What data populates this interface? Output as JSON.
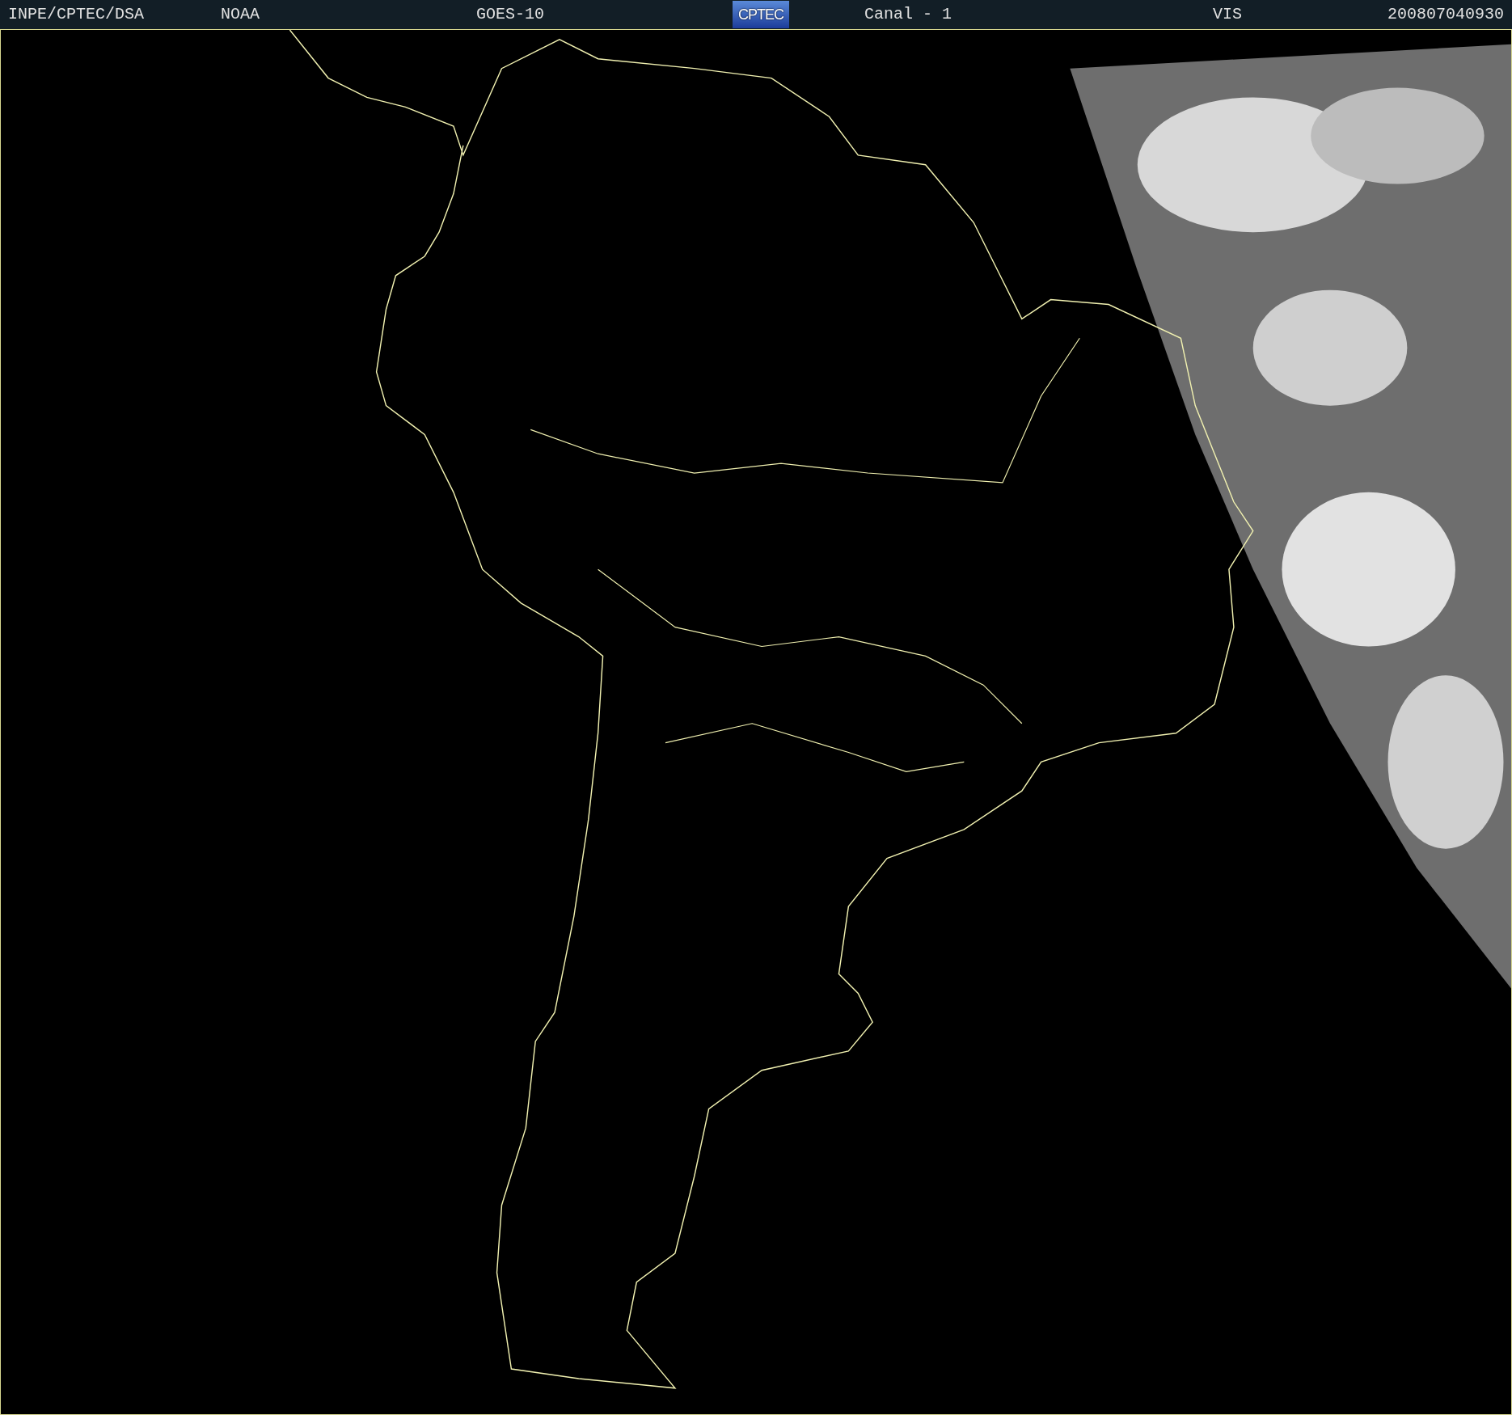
{
  "header": {
    "items": [
      {
        "kind": "text",
        "text": "INPE/CPTEC/DSA"
      },
      {
        "kind": "text",
        "text": "NOAA"
      },
      {
        "kind": "text",
        "text": "GOES-10"
      },
      {
        "kind": "logo",
        "text": "CPTEC"
      },
      {
        "kind": "text",
        "text": "Canal - 1"
      },
      {
        "kind": "text",
        "text": "VIS"
      },
      {
        "kind": "text",
        "text": "200807040930"
      }
    ]
  }
}
